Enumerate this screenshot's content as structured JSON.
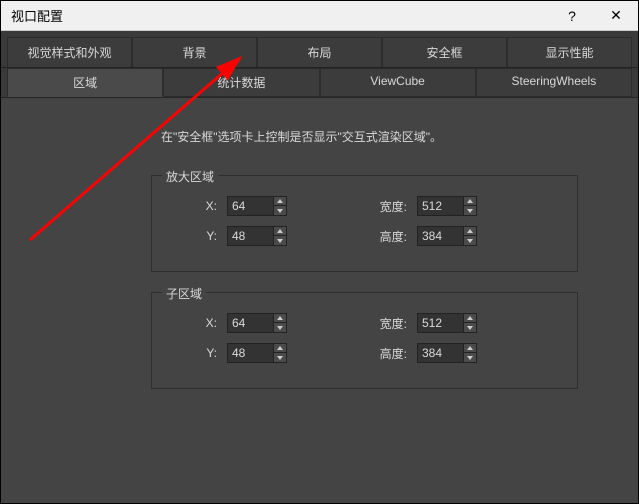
{
  "window": {
    "title": "视口配置"
  },
  "titlebar_controls": {
    "help": "?",
    "close": "✕"
  },
  "tabs": {
    "t0": "视觉样式和外观",
    "t1": "背景",
    "t2": "布局",
    "t3": "安全框",
    "t4": "显示性能"
  },
  "subtabs": {
    "s0": "区域",
    "s1": "统计数据",
    "s2": "ViewCube",
    "s3": "SteeringWheels"
  },
  "description": "在\"安全框\"选项卡上控制是否显示\"交互式渲染区域\"。",
  "groups": {
    "enlarge": {
      "legend": "放大区域",
      "x_label": "X:",
      "x_value": "64",
      "w_label": "宽度:",
      "w_value": "512",
      "y_label": "Y:",
      "y_value": "48",
      "h_label": "高度:",
      "h_value": "384"
    },
    "sub": {
      "legend": "子区域",
      "x_label": "X:",
      "x_value": "64",
      "w_label": "宽度:",
      "w_value": "512",
      "y_label": "Y:",
      "y_value": "48",
      "h_label": "高度:",
      "h_value": "384"
    }
  }
}
